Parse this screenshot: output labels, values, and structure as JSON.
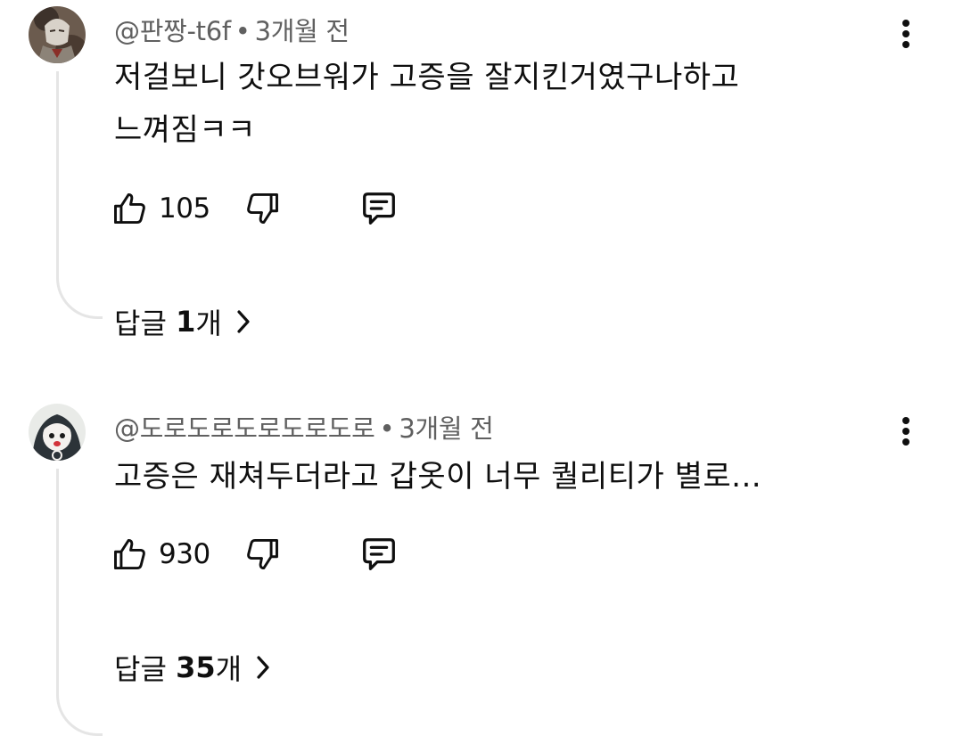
{
  "comments": [
    {
      "author": "@판짱-t6f",
      "separator": "•",
      "time": "3개월 전",
      "text_lines": [
        "저걸보니 갓오브워가 고증을 잘지킨거였구나하고",
        "느껴짐ㅋㅋ"
      ],
      "likes": "105",
      "replies_prefix": "답글",
      "replies_count": "1",
      "replies_suffix": "개",
      "avatar_icon": "avatar-armored-knight",
      "avatar_colors": [
        "#5a4a3e",
        "#c9c2b8",
        "#8a2f28"
      ]
    },
    {
      "author": "@도로도로도로도로도로",
      "separator": "•",
      "time": "3개월 전",
      "text_lines": [
        "고증은 재쳐두더라고 갑옷이 너무 퀄리티가 별로..."
      ],
      "likes": "930",
      "replies_prefix": "답글",
      "replies_count": "35",
      "replies_suffix": "개",
      "avatar_icon": "avatar-anime-girl",
      "avatar_colors": [
        "#2c3338",
        "#f4f1ee",
        "#d2323a"
      ]
    }
  ],
  "icons": {
    "like": "thumbs-up-icon",
    "dislike": "thumbs-down-icon",
    "reply": "reply-comment-icon",
    "more": "more-vertical-icon",
    "chevron": "chevron-right-icon"
  },
  "colors": {
    "text": "#0f0f0f",
    "meta": "#606060",
    "thread_line": "#e5e5e5",
    "background": "#ffffff"
  }
}
